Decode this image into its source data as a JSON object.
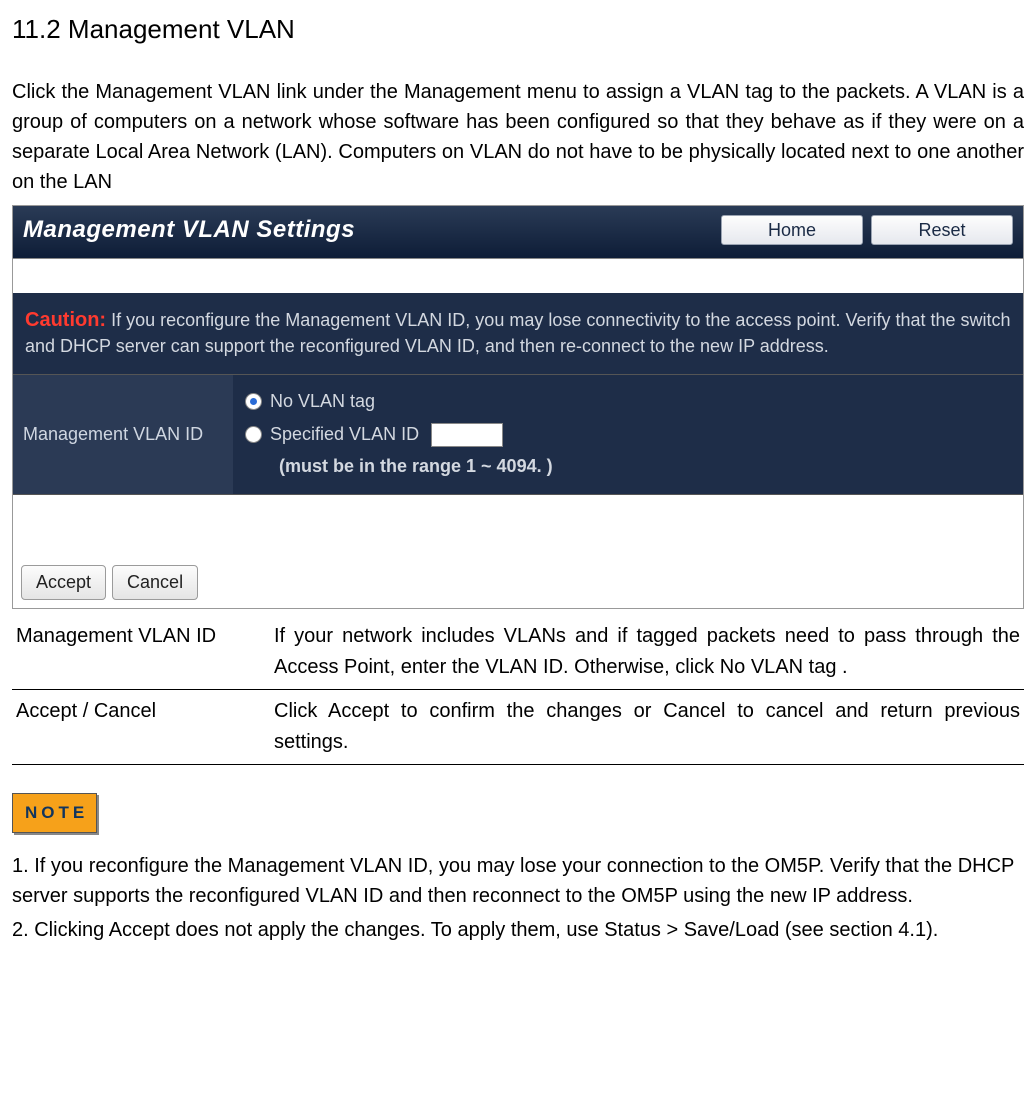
{
  "section": {
    "number": "11.2",
    "title": "Management VLAN"
  },
  "intro": "Click the Management VLAN link under the Management menu to assign a VLAN tag to the packets. A VLAN is a group of computers on a network whose software has been configured so that they behave as if they were on a separate Local Area Network (LAN). Computers on VLAN do not have to be physically located next to one another on the LAN",
  "panel": {
    "title": "Management VLAN Settings",
    "home_btn": "Home",
    "reset_btn": "Reset",
    "caution_word": "Caution:",
    "caution_text": "If you reconfigure the Management VLAN ID, you may lose connectivity to the access point. Verify that the switch and DHCP server can support the reconfigured VLAN ID, and then re-connect to the new IP address.",
    "row_label": "Management VLAN ID",
    "opt_no_tag": "No VLAN tag",
    "opt_specified": "Specified VLAN ID",
    "range_note": "(must be in the range 1 ~ 4094. )",
    "accept_btn": "Accept",
    "cancel_btn": "Cancel"
  },
  "table": {
    "r1_label": "Management VLAN ID",
    "r1_body": "If your network includes VLANs and if tagged packets need to pass through  the Access Point,  enter the VLAN ID. Otherwise, click No VLAN tag .",
    "r2_label": "Accept / Cancel",
    "r2_body": "Click Accept to confirm the changes or Cancel to cancel and return previous settings."
  },
  "note_tag": "NOTE",
  "notes": {
    "n1": "1. If you reconfigure the Management VLAN ID, you may lose your connection to the OM5P. Verify that the DHCP server supports the reconfigured VLAN ID and then reconnect to the OM5P using the new IP address.",
    "n2": "2. Clicking Accept does not apply the changes. To apply them, use Status > Save/Load (see section 4.1)."
  }
}
